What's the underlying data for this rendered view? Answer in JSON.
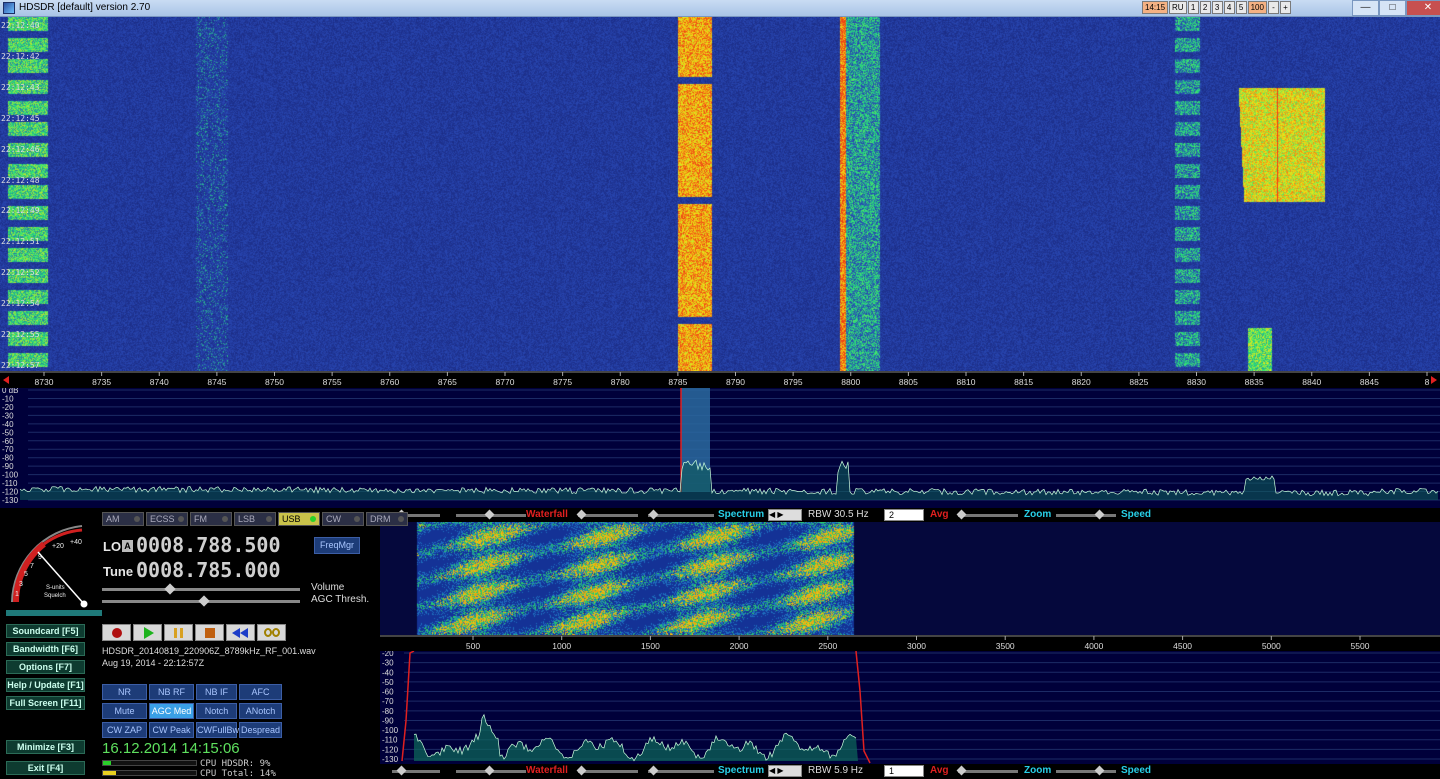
{
  "window": {
    "title": "HDSDR [default]  version 2.70",
    "toolbar_buttons": [
      "14:15",
      "RU",
      "1",
      "2",
      "3",
      "4",
      "5",
      "100",
      "-",
      "+"
    ],
    "controls": [
      "minimize-icon",
      "maximize-icon",
      "close-icon"
    ]
  },
  "waterfall": {
    "time_labels": [
      "22:12:40",
      "22:12:42",
      "22:12:43",
      "22:12:45",
      "22:12:46",
      "22:12:48",
      "22:12:49",
      "22:12:51",
      "22:12:52",
      "22:12:54",
      "22:12:55",
      "22:12:57"
    ]
  },
  "freq_scale": {
    "labels": [
      "8730",
      "8735",
      "8740",
      "8745",
      "8750",
      "8755",
      "8760",
      "8765",
      "8770",
      "8775",
      "8780",
      "8785",
      "8790",
      "8795",
      "8800",
      "8805",
      "8810",
      "8815",
      "8820",
      "8825",
      "8830",
      "8835",
      "8840",
      "8845",
      "8"
    ]
  },
  "spectrum": {
    "db_labels": [
      "0 dB",
      "-10",
      "-20",
      "-30",
      "-40",
      "-50",
      "-60",
      "-70",
      "-80",
      "-90",
      "-100",
      "-110",
      "-120",
      "-130"
    ]
  },
  "modes": {
    "buttons": [
      "AM",
      "ECSS",
      "FM",
      "LSB",
      "USB",
      "CW",
      "DRM"
    ],
    "active": "USB"
  },
  "smeter": {
    "labels": [
      "+40",
      "+20",
      "9",
      "7",
      "5",
      "3",
      "1"
    ],
    "caption1": "S-units",
    "caption2": "Squelch"
  },
  "frequency": {
    "lo_label": "LO",
    "lo_flag": "A",
    "lo_value": "0008.788.500",
    "tune_label": "Tune",
    "tune_value": "0008.785.000",
    "freqmgr": "FreqMgr"
  },
  "sliders": {
    "volume": "Volume",
    "agc_thresh": "AGC Thresh."
  },
  "side_buttons": [
    "Soundcard  [F5]",
    "Bandwidth  [F6]",
    "Options  [F7]",
    "Help / Update  [F1]",
    "Full Screen  [F11]",
    "Minimize  [F3]",
    "Exit  [F4]"
  ],
  "file": {
    "name": "HDSDR_20140819_220906Z_8789kHz_RF_001.wav",
    "date": "Aug 19, 2014 - 22:12:57Z"
  },
  "dsp": {
    "row1": [
      "NR",
      "NB RF",
      "NB IF",
      "AFC"
    ],
    "row2": [
      "Mute",
      "AGC Med",
      "Notch",
      "ANotch"
    ],
    "row3": [
      "CW ZAP",
      "CW Peak",
      "CWFullBw",
      "Despread"
    ],
    "active": "AGC Med"
  },
  "clock": "16.12.2014 14:15:06",
  "cpu": {
    "hdsdr": "CPU HDSDR:  9%",
    "total": "CPU Total: 14%",
    "hdsdr_level": 0.09,
    "total_level": 0.14
  },
  "rf_strip": {
    "waterfall": "Waterfall",
    "spectrum": "Spectrum",
    "rbw": "RBW 30.5 Hz",
    "avg_value": "2",
    "avg": "Avg",
    "zoom": "Zoom",
    "speed": "Speed"
  },
  "af_strip": {
    "waterfall": "Waterfall",
    "spectrum": "Spectrum",
    "rbw": "RBW   5.9 Hz",
    "avg_value": "1",
    "avg": "Avg",
    "zoom": "Zoom",
    "speed": "Speed"
  },
  "af_scale": {
    "labels": [
      "500",
      "1000",
      "1500",
      "2000",
      "2500",
      "3000",
      "3500",
      "4000",
      "4500",
      "5000",
      "5500"
    ]
  },
  "af_spectrum": {
    "db_labels": [
      "-20",
      "-30",
      "-40",
      "-50",
      "-60",
      "-70",
      "-80",
      "-90",
      "-100",
      "-110",
      "-120",
      "-130"
    ]
  },
  "colors": {
    "waterfall_bg": "#1a2a8c",
    "spectrum_bg": "#000040",
    "accent_red": "#e02020",
    "accent_cyan": "#28d0e8",
    "clock_green": "#5ee05e"
  }
}
